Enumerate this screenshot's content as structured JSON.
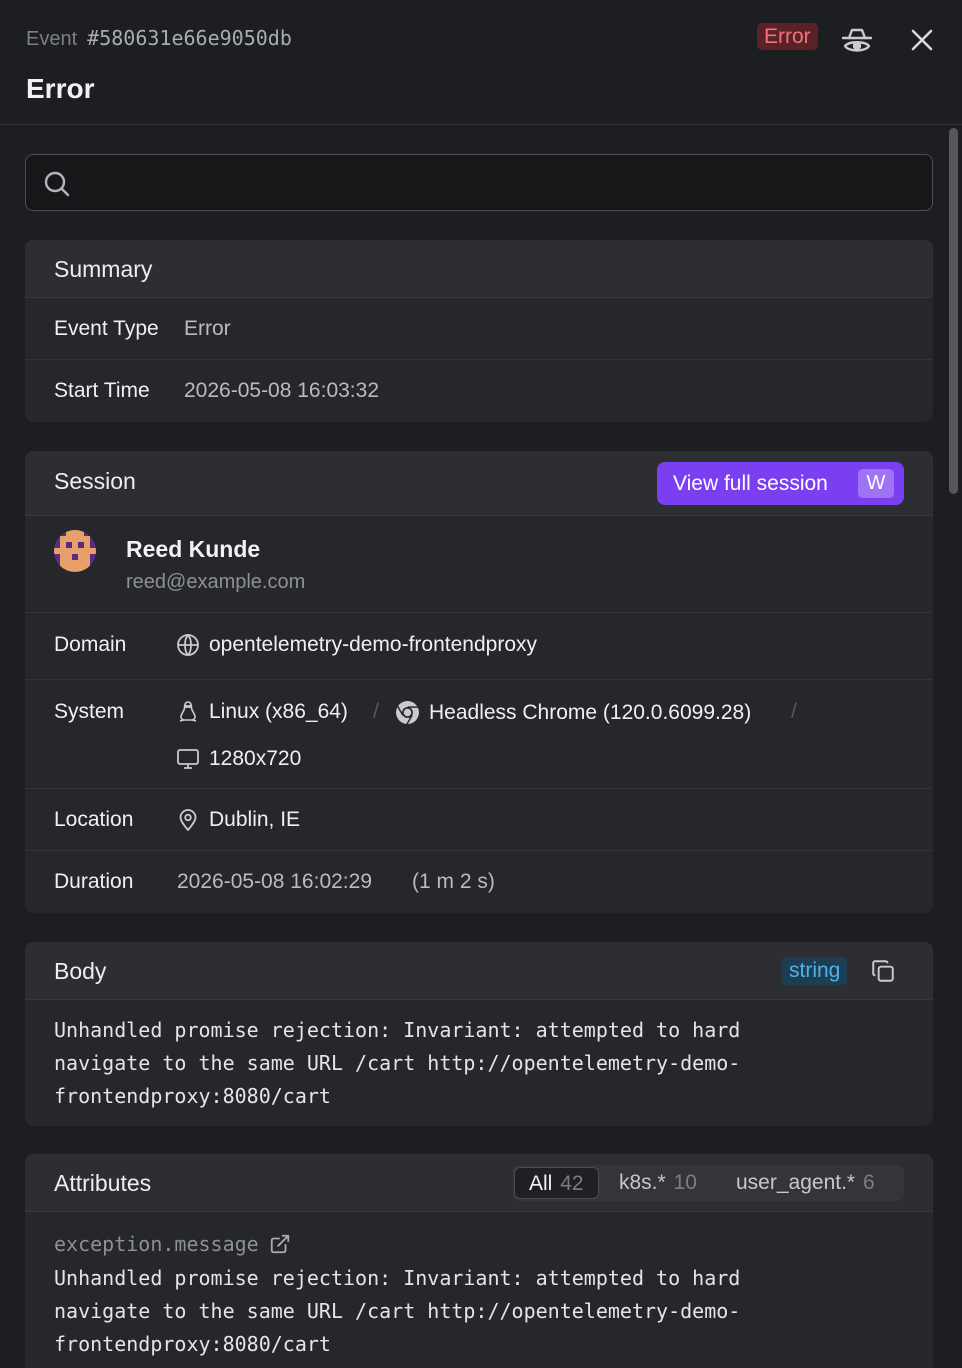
{
  "header": {
    "event_label": "Event",
    "event_id": "#580631e66e9050db",
    "title": "Error",
    "status_badge": "Error"
  },
  "search": {
    "value": "",
    "placeholder": ""
  },
  "summary": {
    "title": "Summary",
    "rows": [
      {
        "label": "Event Type",
        "value": "Error"
      },
      {
        "label": "Start Time",
        "value": "2026-05-08 16:03:32"
      }
    ]
  },
  "session": {
    "title": "Session",
    "view_button": "View full session",
    "view_shortcut": "W",
    "user": {
      "name": "Reed Kunde",
      "email": "reed@example.com"
    },
    "domain": {
      "label": "Domain",
      "value": "opentelemetry-demo-frontendproxy",
      "icon": "globe-icon"
    },
    "system": {
      "label": "System",
      "os": "Linux (x86_64)",
      "os_icon": "linux-icon",
      "browser": "Headless Chrome (120.0.6099.28)",
      "browser_icon": "chrome-icon",
      "screen": "1280x720",
      "screen_icon": "monitor-icon",
      "separator": "/"
    },
    "location": {
      "label": "Location",
      "value": "Dublin, IE",
      "icon": "map-pin-icon"
    },
    "duration": {
      "label": "Duration",
      "start": "2026-05-08 16:02:29",
      "length": "(1 m 2 s)"
    }
  },
  "body": {
    "title": "Body",
    "type_badge": "string",
    "lines": [
      "Unhandled promise rejection: Invariant: attempted to hard",
      "navigate to the same URL /cart http://opentelemetry-demo-",
      "frontendproxy:8080/cart"
    ]
  },
  "attributes": {
    "title": "Attributes",
    "filters": [
      {
        "label": "All",
        "count": "42",
        "active": true
      },
      {
        "label": "k8s.*",
        "count": "10",
        "active": false
      },
      {
        "label": "user_agent.*",
        "count": "6",
        "active": false
      }
    ],
    "items": [
      {
        "key": "exception.message",
        "lines": [
          "Unhandled promise rejection: Invariant: attempted to hard",
          "navigate to the same URL /cart http://opentelemetry-demo-",
          "frontendproxy:8080/cart"
        ]
      }
    ]
  },
  "colors": {
    "background": "#1d1e21",
    "card": "#26272b",
    "accent": "#7b3ff2",
    "error_badge_bg": "#5a2226",
    "error_badge_text": "#f0737a",
    "string_badge_text": "#4db3e6"
  }
}
